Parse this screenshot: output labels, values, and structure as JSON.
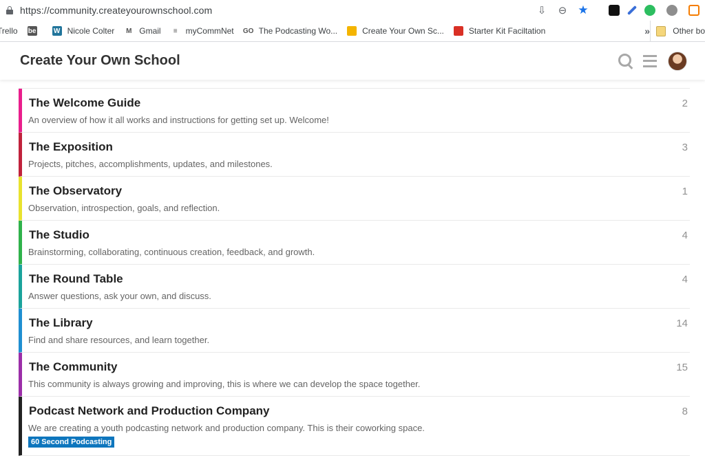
{
  "browser": {
    "url": "https://community.createyourownschool.com",
    "bookmarks": [
      {
        "label": "Trello",
        "icon": "trello-icon",
        "color": "#0079bf",
        "glyph": ""
      },
      {
        "label": "",
        "icon": "behance-icon",
        "color": "#555555",
        "glyph": "be"
      },
      {
        "label": "Nicole Colter",
        "icon": "wordpress-icon",
        "color": "#21759b",
        "glyph": "W"
      },
      {
        "label": "Gmail",
        "icon": "gmail-icon",
        "color": "#ffffff",
        "glyph": "M"
      },
      {
        "label": "myCommNet",
        "icon": "mycommnet-icon",
        "color": "#ffffff",
        "glyph": "≡"
      },
      {
        "label": "The Podcasting Wo...",
        "icon": "go-icon",
        "color": "#ffffff",
        "glyph": "GO"
      },
      {
        "label": "Create Your Own Sc...",
        "icon": "cyos-icon",
        "color": "#f4b400",
        "glyph": ""
      },
      {
        "label": "Starter Kit Faciltation",
        "icon": "starter-kit-icon",
        "color": "#d93025",
        "glyph": ""
      }
    ],
    "more_label": "»",
    "other_bookmarks": "Other bo"
  },
  "site": {
    "title": "Create Your Own School"
  },
  "categories": [
    {
      "name": "The Welcome Guide",
      "description": "An overview of how it all works and instructions for getting set up. Welcome!",
      "count": "2",
      "color": "#e91e8c"
    },
    {
      "name": "The Exposition",
      "description": "Projects, pitches, accomplishments, updates, and milestones.",
      "count": "3",
      "color": "#c0223c"
    },
    {
      "name": "The Observatory",
      "description": "Observation, introspection, goals, and reflection.",
      "count": "1",
      "color": "#e8e22e"
    },
    {
      "name": "The Studio",
      "description": "Brainstorming, collaborating, continuous creation, feedback, and growth.",
      "count": "4",
      "color": "#2fb24b"
    },
    {
      "name": "The Round Table",
      "description": "Answer questions, ask your own, and discuss.",
      "count": "4",
      "color": "#1aa39b"
    },
    {
      "name": "The Library",
      "description": "Find and share resources, and learn together.",
      "count": "14",
      "color": "#1f8fd1"
    },
    {
      "name": "The Community",
      "description": "This community is always growing and improving, this is where we can develop the space together.",
      "count": "15",
      "color": "#9b2ea8"
    },
    {
      "name": "Podcast Network and Production Company",
      "description": "We are creating a youth podcasting network and production company. This is their coworking space.",
      "count": "8",
      "color": "#222222",
      "subcategory": "60 Second Podcasting"
    }
  ]
}
